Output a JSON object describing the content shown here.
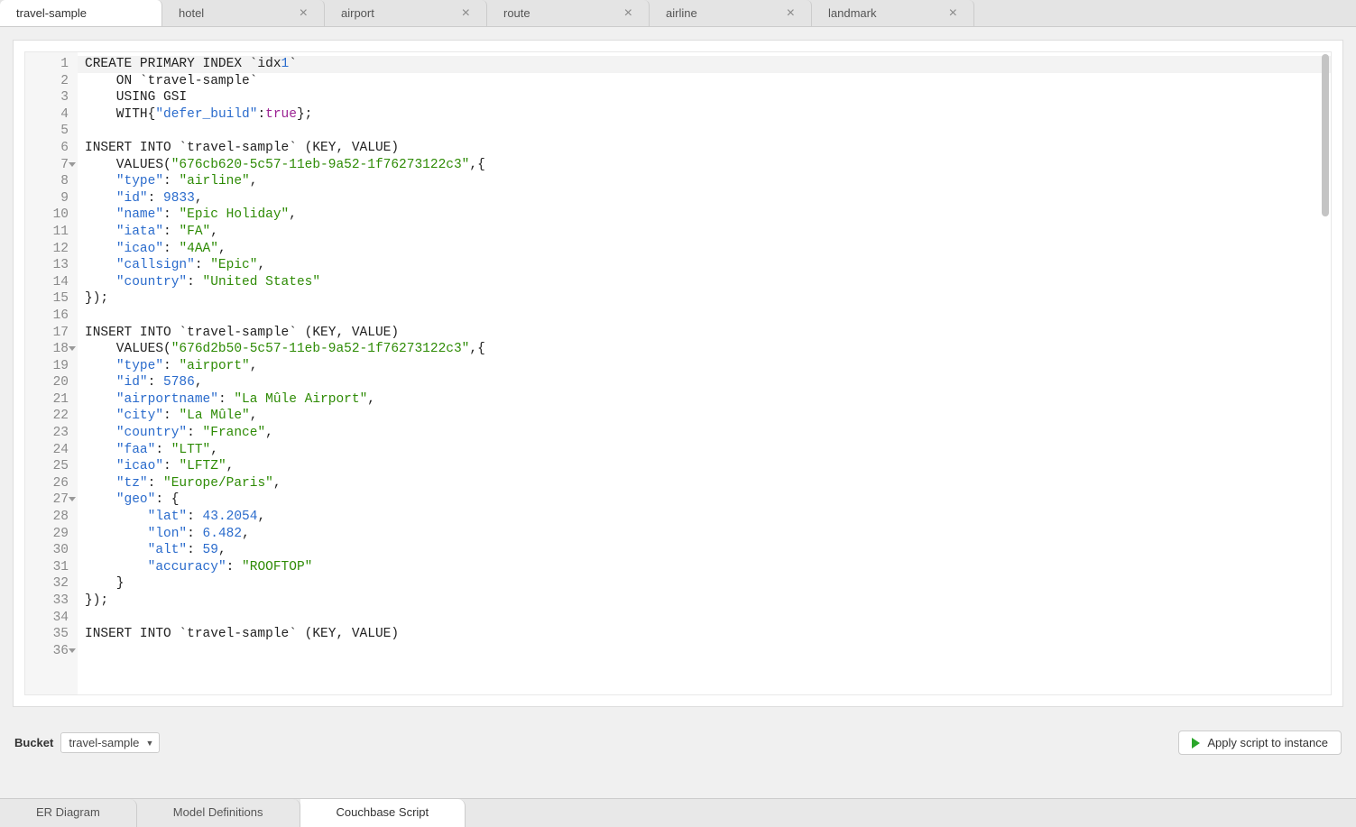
{
  "top_tabs": [
    {
      "label": "travel-sample",
      "closable": false,
      "active": true
    },
    {
      "label": "hotel",
      "closable": true,
      "active": false
    },
    {
      "label": "airport",
      "closable": true,
      "active": false
    },
    {
      "label": "route",
      "closable": true,
      "active": false
    },
    {
      "label": "airline",
      "closable": true,
      "active": false
    },
    {
      "label": "landmark",
      "closable": true,
      "active": false
    }
  ],
  "editor": {
    "code_lines": [
      {
        "n": 1,
        "active": true,
        "segs": [
          {
            "t": "CREATE PRIMARY INDEX `idx"
          },
          {
            "t": "1",
            "c": "kw-num"
          },
          {
            "t": "`"
          }
        ]
      },
      {
        "n": 2,
        "segs": [
          {
            "t": "    ON `travel-sample`"
          }
        ]
      },
      {
        "n": 3,
        "segs": [
          {
            "t": "    USING GSI"
          }
        ]
      },
      {
        "n": 4,
        "segs": [
          {
            "t": "    WITH{"
          },
          {
            "t": "\"defer_build\"",
            "c": "kw-key"
          },
          {
            "t": ":"
          },
          {
            "t": "true",
            "c": "kw-bool"
          },
          {
            "t": "};"
          }
        ]
      },
      {
        "n": 5,
        "segs": [
          {
            "t": ""
          }
        ]
      },
      {
        "n": 6,
        "segs": [
          {
            "t": "INSERT INTO `travel-sample` (KEY, VALUE)"
          }
        ]
      },
      {
        "n": 7,
        "fold": true,
        "segs": [
          {
            "t": "    VALUES("
          },
          {
            "t": "\"676cb620-5c57-11eb-9a52-1f76273122c3\"",
            "c": "kw-str"
          },
          {
            "t": ",{"
          }
        ]
      },
      {
        "n": 8,
        "segs": [
          {
            "t": "    "
          },
          {
            "t": "\"type\"",
            "c": "kw-key"
          },
          {
            "t": ": "
          },
          {
            "t": "\"airline\"",
            "c": "kw-str"
          },
          {
            "t": ","
          }
        ]
      },
      {
        "n": 9,
        "segs": [
          {
            "t": "    "
          },
          {
            "t": "\"id\"",
            "c": "kw-key"
          },
          {
            "t": ": "
          },
          {
            "t": "9833",
            "c": "kw-num"
          },
          {
            "t": ","
          }
        ]
      },
      {
        "n": 10,
        "segs": [
          {
            "t": "    "
          },
          {
            "t": "\"name\"",
            "c": "kw-key"
          },
          {
            "t": ": "
          },
          {
            "t": "\"Epic Holiday\"",
            "c": "kw-str"
          },
          {
            "t": ","
          }
        ]
      },
      {
        "n": 11,
        "segs": [
          {
            "t": "    "
          },
          {
            "t": "\"iata\"",
            "c": "kw-key"
          },
          {
            "t": ": "
          },
          {
            "t": "\"FA\"",
            "c": "kw-str"
          },
          {
            "t": ","
          }
        ]
      },
      {
        "n": 12,
        "segs": [
          {
            "t": "    "
          },
          {
            "t": "\"icao\"",
            "c": "kw-key"
          },
          {
            "t": ": "
          },
          {
            "t": "\"4AA\"",
            "c": "kw-str"
          },
          {
            "t": ","
          }
        ]
      },
      {
        "n": 13,
        "segs": [
          {
            "t": "    "
          },
          {
            "t": "\"callsign\"",
            "c": "kw-key"
          },
          {
            "t": ": "
          },
          {
            "t": "\"Epic\"",
            "c": "kw-str"
          },
          {
            "t": ","
          }
        ]
      },
      {
        "n": 14,
        "segs": [
          {
            "t": "    "
          },
          {
            "t": "\"country\"",
            "c": "kw-key"
          },
          {
            "t": ": "
          },
          {
            "t": "\"United States\"",
            "c": "kw-str"
          }
        ]
      },
      {
        "n": 15,
        "segs": [
          {
            "t": "});"
          }
        ]
      },
      {
        "n": 16,
        "segs": [
          {
            "t": ""
          }
        ]
      },
      {
        "n": 17,
        "segs": [
          {
            "t": "INSERT INTO `travel-sample` (KEY, VALUE)"
          }
        ]
      },
      {
        "n": 18,
        "fold": true,
        "segs": [
          {
            "t": "    VALUES("
          },
          {
            "t": "\"676d2b50-5c57-11eb-9a52-1f76273122c3\"",
            "c": "kw-str"
          },
          {
            "t": ",{"
          }
        ]
      },
      {
        "n": 19,
        "segs": [
          {
            "t": "    "
          },
          {
            "t": "\"type\"",
            "c": "kw-key"
          },
          {
            "t": ": "
          },
          {
            "t": "\"airport\"",
            "c": "kw-str"
          },
          {
            "t": ","
          }
        ]
      },
      {
        "n": 20,
        "segs": [
          {
            "t": "    "
          },
          {
            "t": "\"id\"",
            "c": "kw-key"
          },
          {
            "t": ": "
          },
          {
            "t": "5786",
            "c": "kw-num"
          },
          {
            "t": ","
          }
        ]
      },
      {
        "n": 21,
        "segs": [
          {
            "t": "    "
          },
          {
            "t": "\"airportname\"",
            "c": "kw-key"
          },
          {
            "t": ": "
          },
          {
            "t": "\"La Mûle Airport\"",
            "c": "kw-str"
          },
          {
            "t": ","
          }
        ]
      },
      {
        "n": 22,
        "segs": [
          {
            "t": "    "
          },
          {
            "t": "\"city\"",
            "c": "kw-key"
          },
          {
            "t": ": "
          },
          {
            "t": "\"La Mûle\"",
            "c": "kw-str"
          },
          {
            "t": ","
          }
        ]
      },
      {
        "n": 23,
        "segs": [
          {
            "t": "    "
          },
          {
            "t": "\"country\"",
            "c": "kw-key"
          },
          {
            "t": ": "
          },
          {
            "t": "\"France\"",
            "c": "kw-str"
          },
          {
            "t": ","
          }
        ]
      },
      {
        "n": 24,
        "segs": [
          {
            "t": "    "
          },
          {
            "t": "\"faa\"",
            "c": "kw-key"
          },
          {
            "t": ": "
          },
          {
            "t": "\"LTT\"",
            "c": "kw-str"
          },
          {
            "t": ","
          }
        ]
      },
      {
        "n": 25,
        "segs": [
          {
            "t": "    "
          },
          {
            "t": "\"icao\"",
            "c": "kw-key"
          },
          {
            "t": ": "
          },
          {
            "t": "\"LFTZ\"",
            "c": "kw-str"
          },
          {
            "t": ","
          }
        ]
      },
      {
        "n": 26,
        "segs": [
          {
            "t": "    "
          },
          {
            "t": "\"tz\"",
            "c": "kw-key"
          },
          {
            "t": ": "
          },
          {
            "t": "\"Europe/Paris\"",
            "c": "kw-str"
          },
          {
            "t": ","
          }
        ]
      },
      {
        "n": 27,
        "fold": true,
        "segs": [
          {
            "t": "    "
          },
          {
            "t": "\"geo\"",
            "c": "kw-key"
          },
          {
            "t": ": {"
          }
        ]
      },
      {
        "n": 28,
        "segs": [
          {
            "t": "        "
          },
          {
            "t": "\"lat\"",
            "c": "kw-key"
          },
          {
            "t": ": "
          },
          {
            "t": "43.2054",
            "c": "kw-num"
          },
          {
            "t": ","
          }
        ]
      },
      {
        "n": 29,
        "segs": [
          {
            "t": "        "
          },
          {
            "t": "\"lon\"",
            "c": "kw-key"
          },
          {
            "t": ": "
          },
          {
            "t": "6.482",
            "c": "kw-num"
          },
          {
            "t": ","
          }
        ]
      },
      {
        "n": 30,
        "segs": [
          {
            "t": "        "
          },
          {
            "t": "\"alt\"",
            "c": "kw-key"
          },
          {
            "t": ": "
          },
          {
            "t": "59",
            "c": "kw-num"
          },
          {
            "t": ","
          }
        ]
      },
      {
        "n": 31,
        "segs": [
          {
            "t": "        "
          },
          {
            "t": "\"accuracy\"",
            "c": "kw-key"
          },
          {
            "t": ": "
          },
          {
            "t": "\"ROOFTOP\"",
            "c": "kw-str"
          }
        ]
      },
      {
        "n": 32,
        "segs": [
          {
            "t": "    }"
          }
        ]
      },
      {
        "n": 33,
        "segs": [
          {
            "t": "});"
          }
        ]
      },
      {
        "n": 34,
        "segs": [
          {
            "t": ""
          }
        ]
      },
      {
        "n": 35,
        "segs": [
          {
            "t": "INSERT INTO `travel-sample` (KEY, VALUE)"
          }
        ]
      },
      {
        "n": 36,
        "fold": true,
        "segs": [
          {
            "t": ""
          }
        ]
      }
    ]
  },
  "toolbar": {
    "bucket_label": "Bucket",
    "bucket_value": "travel-sample",
    "apply_label": "Apply script to instance"
  },
  "bottom_tabs": [
    {
      "label": "ER Diagram",
      "active": false
    },
    {
      "label": "Model Definitions",
      "active": false
    },
    {
      "label": "Couchbase Script",
      "active": true
    }
  ]
}
